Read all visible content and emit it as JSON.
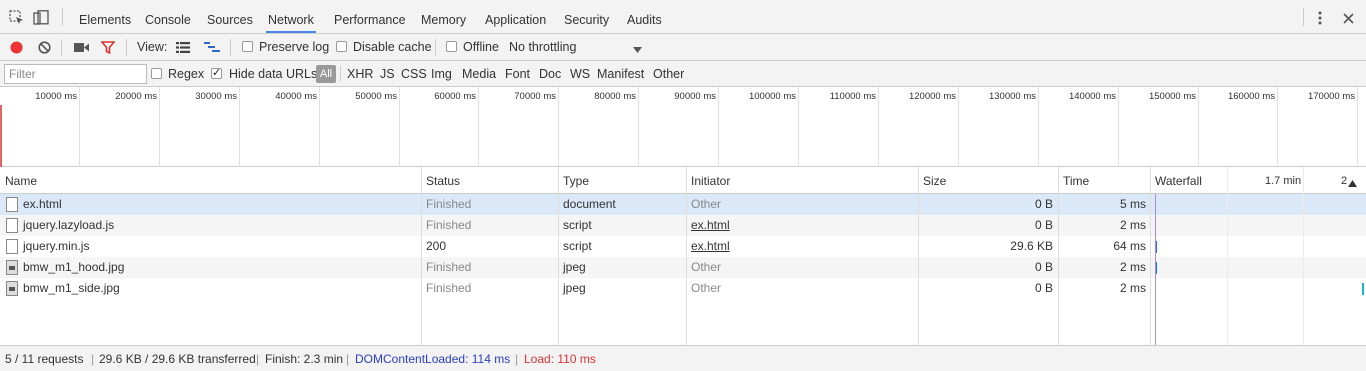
{
  "tabs": [
    "Elements",
    "Console",
    "Sources",
    "Network",
    "Performance",
    "Memory",
    "Application",
    "Security",
    "Audits"
  ],
  "active_tab": "Network",
  "toolbar": {
    "view_label": "View:",
    "preserve_log": "Preserve log",
    "disable_cache": "Disable cache",
    "offline": "Offline",
    "throttling": "No throttling"
  },
  "filterbar": {
    "filter_placeholder": "Filter",
    "regex": "Regex",
    "hide_data_urls": "Hide data URLs",
    "types": [
      "All",
      "XHR",
      "JS",
      "CSS",
      "Img",
      "Media",
      "Font",
      "Doc",
      "WS",
      "Manifest",
      "Other"
    ]
  },
  "overview": {
    "ticks": [
      "10000 ms",
      "20000 ms",
      "30000 ms",
      "40000 ms",
      "50000 ms",
      "60000 ms",
      "70000 ms",
      "80000 ms",
      "90000 ms",
      "100000 ms",
      "110000 ms",
      "120000 ms",
      "130000 ms",
      "140000 ms",
      "150000 ms",
      "160000 ms",
      "170000 ms"
    ]
  },
  "table": {
    "headers": {
      "name": "Name",
      "status": "Status",
      "type": "Type",
      "initiator": "Initiator",
      "size": "Size",
      "time": "Time",
      "waterfall": "Waterfall",
      "wf_tick1": "1.7 min",
      "wf_tick2": "2"
    },
    "rows": [
      {
        "name": "ex.html",
        "status": "Finished",
        "type": "document",
        "initiator": "Other",
        "size": "0 B",
        "time": "5 ms"
      },
      {
        "name": "jquery.lazyload.js",
        "status": "Finished",
        "type": "script",
        "initiator": "ex.html",
        "size": "0 B",
        "time": "2 ms"
      },
      {
        "name": "jquery.min.js",
        "status": "200",
        "type": "script",
        "initiator": "ex.html",
        "size": "29.6 KB",
        "time": "64 ms"
      },
      {
        "name": "bmw_m1_hood.jpg",
        "status": "Finished",
        "type": "jpeg",
        "initiator": "Other",
        "size": "0 B",
        "time": "2 ms"
      },
      {
        "name": "bmw_m1_side.jpg",
        "status": "Finished",
        "type": "jpeg",
        "initiator": "Other",
        "size": "0 B",
        "time": "2 ms"
      }
    ]
  },
  "statusbar": {
    "requests": "5 / 11 requests",
    "transferred": "29.6 KB / 29.6 KB transferred",
    "finish": "Finish: 2.3 min",
    "dcl": "DOMContentLoaded: 114 ms",
    "load": "Load: 110 ms"
  },
  "colors": {
    "record": "#e33",
    "filter_icon": "#d33",
    "accent": "#4a86e8",
    "dcl": "#2a3fc2",
    "load": "#d33"
  }
}
